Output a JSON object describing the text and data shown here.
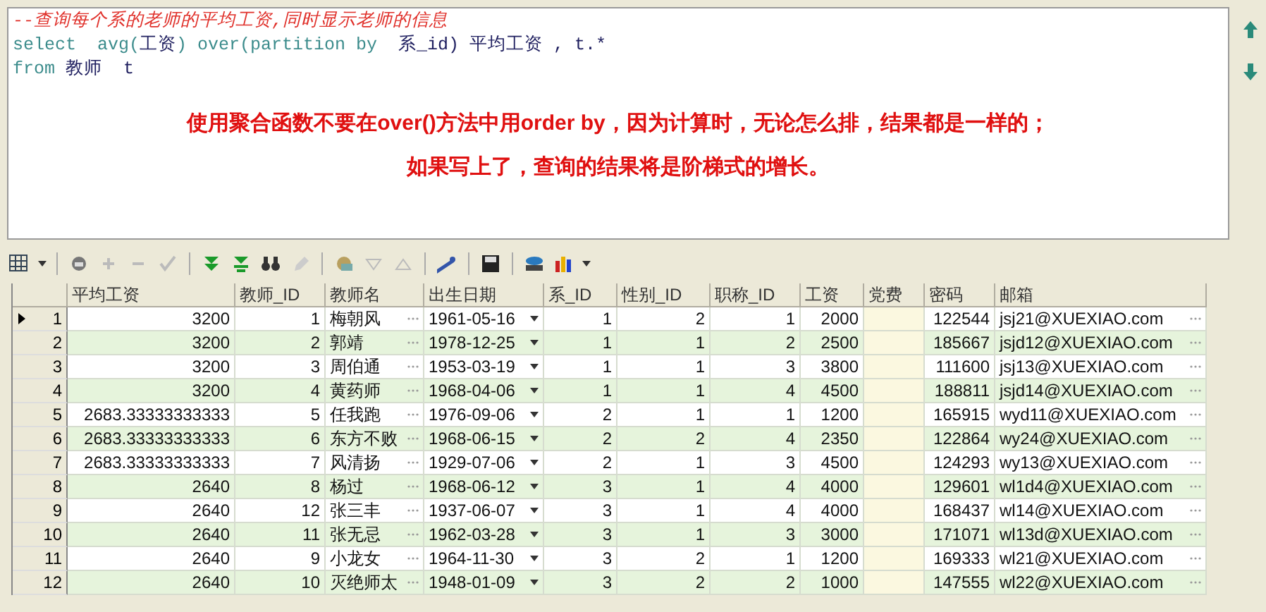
{
  "editor": {
    "lines": [
      [
        {
          "kind": "comment",
          "text": "--查询每个系的老师的平均工资,同时显示老师的信息"
        }
      ],
      [
        {
          "kind": "keyword",
          "text": "select  avg("
        },
        {
          "kind": "ident",
          "text": "工资"
        },
        {
          "kind": "keyword",
          "text": ") over(partition by  "
        },
        {
          "kind": "ident",
          "text": "系_id) 平均工资 , t.*"
        }
      ],
      [
        {
          "kind": "keyword",
          "text": "from "
        },
        {
          "kind": "ident",
          "text": "教师  t"
        }
      ]
    ],
    "notes": [
      "使用聚合函数不要在over()方法中用order by，因为计算时，无论怎么排，结果都是一样的；",
      "如果写上了，查询的结果将是阶梯式的增长。"
    ]
  },
  "grid": {
    "columns": [
      "平均工资",
      "教师_ID",
      "教师名",
      "出生日期",
      "系_ID",
      "性别_ID",
      "职称_ID",
      "工资",
      "党费",
      "密码",
      "邮箱"
    ],
    "rows": [
      {
        "number": "1",
        "current": true,
        "cells": [
          "3200",
          "1",
          "梅朝风",
          "1961-05-16",
          "1",
          "2",
          "1",
          "2000",
          "",
          "122544",
          "jsj21@XUEXIAO.com"
        ]
      },
      {
        "number": "2",
        "current": false,
        "cells": [
          "3200",
          "2",
          "郭靖",
          "1978-12-25",
          "1",
          "1",
          "2",
          "2500",
          "",
          "185667",
          "jsjd12@XUEXIAO.com"
        ]
      },
      {
        "number": "3",
        "current": false,
        "cells": [
          "3200",
          "3",
          "周伯通",
          "1953-03-19",
          "1",
          "1",
          "3",
          "3800",
          "",
          "111600",
          "jsj13@XUEXIAO.com"
        ]
      },
      {
        "number": "4",
        "current": false,
        "cells": [
          "3200",
          "4",
          "黄药师",
          "1968-04-06",
          "1",
          "1",
          "4",
          "4500",
          "",
          "188811",
          "jsjd14@XUEXIAO.com"
        ]
      },
      {
        "number": "5",
        "current": false,
        "cells": [
          "2683.33333333333",
          "5",
          "任我跑",
          "1976-09-06",
          "2",
          "1",
          "1",
          "1200",
          "",
          "165915",
          "wyd11@XUEXIAO.com"
        ]
      },
      {
        "number": "6",
        "current": false,
        "cells": [
          "2683.33333333333",
          "6",
          "东方不败",
          "1968-06-15",
          "2",
          "2",
          "4",
          "2350",
          "",
          "122864",
          "wy24@XUEXIAO.com"
        ]
      },
      {
        "number": "7",
        "current": false,
        "cells": [
          "2683.33333333333",
          "7",
          "风清扬",
          "1929-07-06",
          "2",
          "1",
          "3",
          "4500",
          "",
          "124293",
          "wy13@XUEXIAO.com"
        ]
      },
      {
        "number": "8",
        "current": false,
        "cells": [
          "2640",
          "8",
          "杨过",
          "1968-06-12",
          "3",
          "1",
          "4",
          "4000",
          "",
          "129601",
          "wl1d4@XUEXIAO.com"
        ]
      },
      {
        "number": "9",
        "current": false,
        "cells": [
          "2640",
          "12",
          "张三丰",
          "1937-06-07",
          "3",
          "1",
          "4",
          "4000",
          "",
          "168437",
          "wl14@XUEXIAO.com"
        ]
      },
      {
        "number": "10",
        "current": false,
        "cells": [
          "2640",
          "11",
          "张无忌",
          "1962-03-28",
          "3",
          "1",
          "3",
          "3000",
          "",
          "171071",
          "wl13d@XUEXIAO.com"
        ]
      },
      {
        "number": "11",
        "current": false,
        "cells": [
          "2640",
          "9",
          "小龙女",
          "1964-11-30",
          "3",
          "2",
          "1",
          "1200",
          "",
          "169333",
          "wl21@XUEXIAO.com"
        ]
      },
      {
        "number": "12",
        "current": false,
        "cells": [
          "2640",
          "10",
          "灭绝师太",
          "1948-01-09",
          "3",
          "2",
          "2",
          "1000",
          "",
          "147555",
          "wl22@XUEXIAO.com"
        ]
      }
    ]
  }
}
